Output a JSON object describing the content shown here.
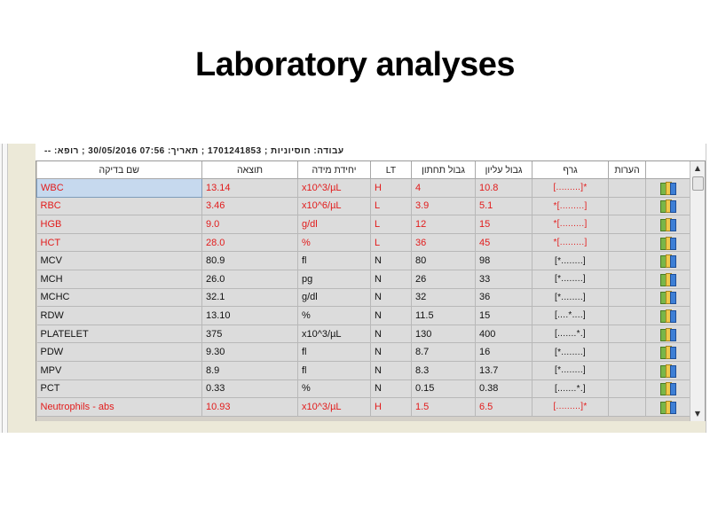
{
  "title": "Laboratory analyses",
  "header_strip": "עבודה: חוסיוניות ; 1701241853 ; תאריך: 07:56 30/05/2016 ; רופא: --",
  "columns": {
    "name": "שם בדיקה",
    "result": "תוצאה",
    "unit": "יחידת מידה",
    "lt": "LT",
    "lower": "גבול תחתון",
    "upper": "גבול עליון",
    "graph": "גרף",
    "notes": "הערות"
  },
  "rows": [
    {
      "name": "WBC",
      "result": "13.14",
      "unit": "x10^3/µL",
      "lt": "H",
      "lower": "4",
      "upper": "10.8",
      "graph": "[.........]*",
      "abnormal": true
    },
    {
      "name": "RBC",
      "result": "3.46",
      "unit": "x10^6/µL",
      "lt": "L",
      "lower": "3.9",
      "upper": "5.1",
      "graph": "*[.........]",
      "abnormal": true
    },
    {
      "name": "HGB",
      "result": "9.0",
      "unit": "g/dl",
      "lt": "L",
      "lower": "12",
      "upper": "15",
      "graph": "*[.........]",
      "abnormal": true
    },
    {
      "name": "HCT",
      "result": "28.0",
      "unit": "%",
      "lt": "L",
      "lower": "36",
      "upper": "45",
      "graph": "*[.........]",
      "abnormal": true
    },
    {
      "name": "MCV",
      "result": "80.9",
      "unit": "fl",
      "lt": "N",
      "lower": "80",
      "upper": "98",
      "graph": "[*........]",
      "abnormal": false
    },
    {
      "name": "MCH",
      "result": "26.0",
      "unit": "pg",
      "lt": "N",
      "lower": "26",
      "upper": "33",
      "graph": "[*........]",
      "abnormal": false
    },
    {
      "name": "MCHC",
      "result": "32.1",
      "unit": "g/dl",
      "lt": "N",
      "lower": "32",
      "upper": "36",
      "graph": "[*........]",
      "abnormal": false
    },
    {
      "name": "RDW",
      "result": "13.10",
      "unit": "%",
      "lt": "N",
      "lower": "11.5",
      "upper": "15",
      "graph": "[....*....]",
      "abnormal": false
    },
    {
      "name": "PLATELET",
      "result": "375",
      "unit": "x10^3/µL",
      "lt": "N",
      "lower": "130",
      "upper": "400",
      "graph": "[.......*.]",
      "abnormal": false
    },
    {
      "name": "PDW",
      "result": "9.30",
      "unit": "fl",
      "lt": "N",
      "lower": "8.7",
      "upper": "16",
      "graph": "[*........]",
      "abnormal": false
    },
    {
      "name": "MPV",
      "result": "8.9",
      "unit": "fl",
      "lt": "N",
      "lower": "8.3",
      "upper": "13.7",
      "graph": "[*........]",
      "abnormal": false
    },
    {
      "name": "PCT",
      "result": "0.33",
      "unit": "%",
      "lt": "N",
      "lower": "0.15",
      "upper": "0.38",
      "graph": "[.......*.]",
      "abnormal": false
    },
    {
      "name": "Neutrophils - abs",
      "result": "10.93",
      "unit": "x10^3/µL",
      "lt": "H",
      "lower": "1.5",
      "upper": "6.5",
      "graph": "[.........]*",
      "abnormal": true
    }
  ],
  "selected_row": 0,
  "row_icon": "report-book-icon",
  "colors": {
    "abnormal": "#e21b1b",
    "normal": "#111111",
    "selection": "#c6d9ee"
  }
}
